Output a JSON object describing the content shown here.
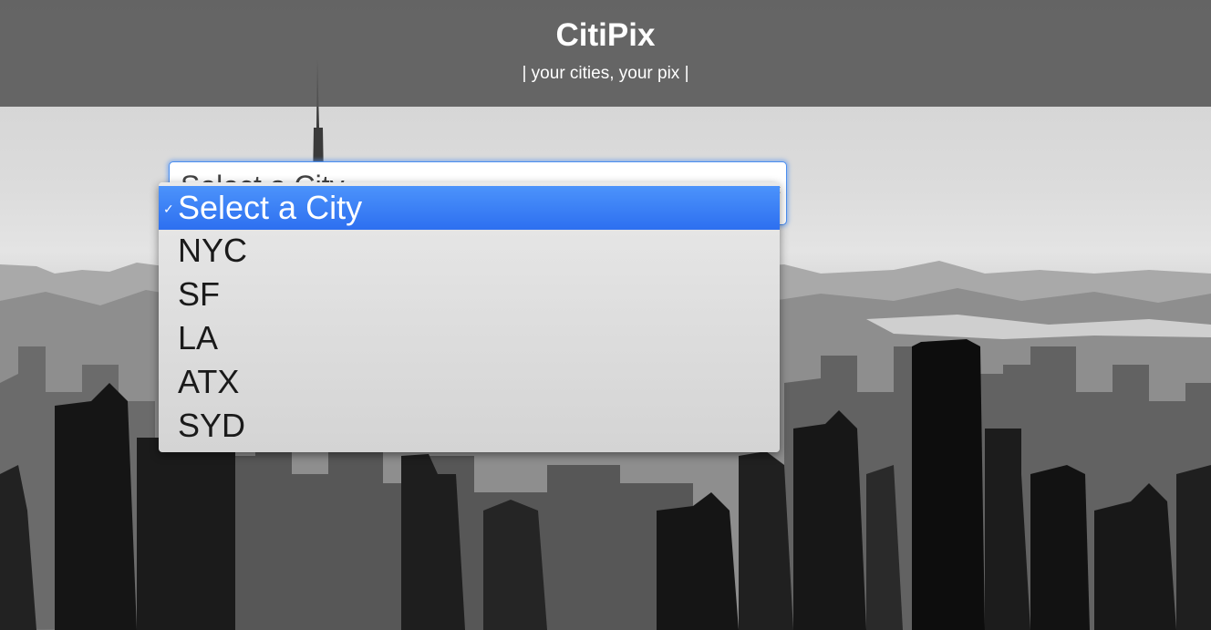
{
  "header": {
    "title": "CitiPix",
    "tagline": "| your cities, your pix |"
  },
  "city_select": {
    "selected_value": "Select a City",
    "options": [
      "Select a City",
      "NYC",
      "SF",
      "LA",
      "ATX",
      "SYD"
    ]
  },
  "icons": {
    "check": "check-icon",
    "select_arrows": "select-arrows-icon"
  },
  "colors": {
    "header_bg": "#555555",
    "selected_option_bg": "#3b7ff5",
    "focus_ring": "#4a8ef0"
  }
}
